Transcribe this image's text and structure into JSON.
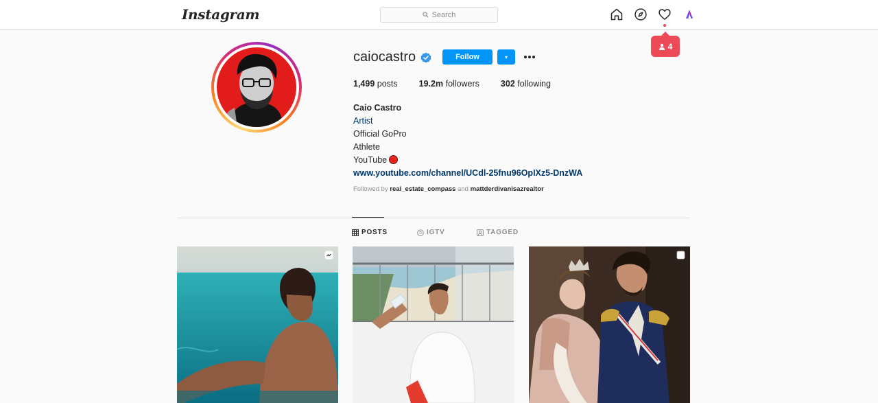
{
  "nav": {
    "logo": "Instagram",
    "search_placeholder": "Search",
    "notification_count": "4"
  },
  "profile": {
    "username": "caiocastro",
    "follow_label": "Follow",
    "dropdown_label": "▾",
    "stats": {
      "posts_count": "1,499",
      "posts_label": "posts",
      "followers_count": "19.2m",
      "followers_label": "followers",
      "following_count": "302",
      "following_label": "following"
    },
    "bio": {
      "name": "Caio Castro",
      "category": "Artist",
      "line1": "Official GoPro",
      "line2": "Athlete",
      "line3": "YouTube",
      "link": "www.youtube.com/channel/UCdl-25fnu96OpIXz5-DnzWA"
    },
    "followed_by": {
      "prefix": "Followed by",
      "user1": "real_estate_compass",
      "conj": "and",
      "user2": "mattderdivanisazrealtor"
    }
  },
  "tabs": [
    {
      "label": "POSTS",
      "icon": "grid-icon"
    },
    {
      "label": "IGTV",
      "icon": "igtv-icon"
    },
    {
      "label": "TAGGED",
      "icon": "tagged-icon"
    }
  ],
  "posts": [
    {
      "kind": "reel",
      "badge": "reel-icon"
    },
    {
      "kind": "photo"
    },
    {
      "kind": "carousel",
      "badge": "carousel-icon"
    }
  ],
  "colors": {
    "accent": "#0095f6",
    "notification": "#ed4956",
    "link": "#00376b"
  }
}
